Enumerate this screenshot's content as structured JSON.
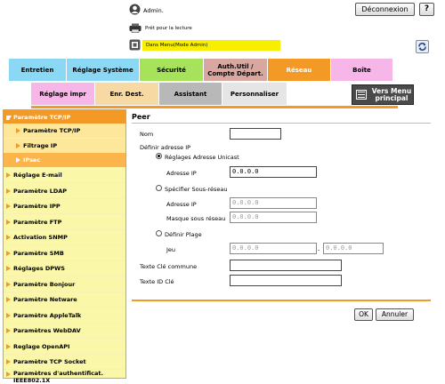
{
  "header": {
    "user_label": "Admin.",
    "logout_label": "Déconnexion",
    "help_label": "?",
    "status_label": "Prêt pour la lecture",
    "mode_label": "Dans Menu(Mode Admin)"
  },
  "tabs_row1": [
    {
      "label": "Entretien",
      "color": "#8ad8f4"
    },
    {
      "label": "Réglage Système",
      "color": "#8ad8f4"
    },
    {
      "label": "Sécurité",
      "color": "#a6e25a"
    },
    {
      "label": "Auth.Util / Compte Départ.",
      "color": "#d8a8a0"
    },
    {
      "label": "Réseau",
      "color": "#f39a26"
    },
    {
      "label": "Boîte",
      "color": "#f7b6e8"
    }
  ],
  "tabs_row2": [
    {
      "label": "Réglage impr",
      "color": "#f7b6e8"
    },
    {
      "label": "Enr. Dest.",
      "color": "#f7d9a4"
    },
    {
      "label": "Assistant",
      "color": "#b8b8b8"
    },
    {
      "label": "Personnaliser",
      "color": "#e5e5e5"
    }
  ],
  "menu_button": {
    "label": "Vers Menu principal"
  },
  "sidebar": {
    "items": [
      {
        "label": "Paramètre TCP/IP",
        "state": "active"
      },
      {
        "label": "Paramètre TCP/IP",
        "state": "sub"
      },
      {
        "label": "Filtrage IP",
        "state": "sub"
      },
      {
        "label": "IPsec",
        "state": "selected"
      },
      {
        "label": "Réglage E-mail",
        "state": ""
      },
      {
        "label": "Paramètre LDAP",
        "state": ""
      },
      {
        "label": "Paramètre IPP",
        "state": ""
      },
      {
        "label": "Paramètre FTP",
        "state": ""
      },
      {
        "label": "Activation SNMP",
        "state": ""
      },
      {
        "label": "Paramètre SMB",
        "state": ""
      },
      {
        "label": "Réglages DPWS",
        "state": ""
      },
      {
        "label": "Paramètre Bonjour",
        "state": ""
      },
      {
        "label": "Paramètre Netware",
        "state": ""
      },
      {
        "label": "Paramètre AppleTalk",
        "state": ""
      },
      {
        "label": "Paramètres WebDAV",
        "state": ""
      },
      {
        "label": "Reglage OpenAPI",
        "state": ""
      },
      {
        "label": "Paramètre TCP Socket",
        "state": ""
      },
      {
        "label": "Paramètres d'authentificat. IEEE802.1X",
        "state": ""
      }
    ]
  },
  "form": {
    "title": "Peer",
    "nom_label": "Nom",
    "nom_value": "",
    "define_ip_label": "Définir adresse IP",
    "unicast_label": "Réglages Adresse Unicast",
    "ip_label": "Adresse IP",
    "ip_value": "0.0.0.0",
    "subnet_radio_label": "Spécifier Sous-réseau",
    "subnet_ip_label": "Adresse IP",
    "subnet_ip_value": "0.0.0.0",
    "mask_label": "Masque sous réseau",
    "mask_value": "0.0.0.0",
    "range_label": "Définir Plage",
    "jeu_label": "Jeu",
    "range_start": "0.0.0.0",
    "range_sep": "-",
    "range_end": "0.0.0.0",
    "common_key_label": "Texte Clé commune",
    "common_key_value": "",
    "key_id_label": "Texte ID Clé",
    "key_id_value": ""
  },
  "buttons": {
    "ok": "OK",
    "cancel": "Annuler"
  }
}
